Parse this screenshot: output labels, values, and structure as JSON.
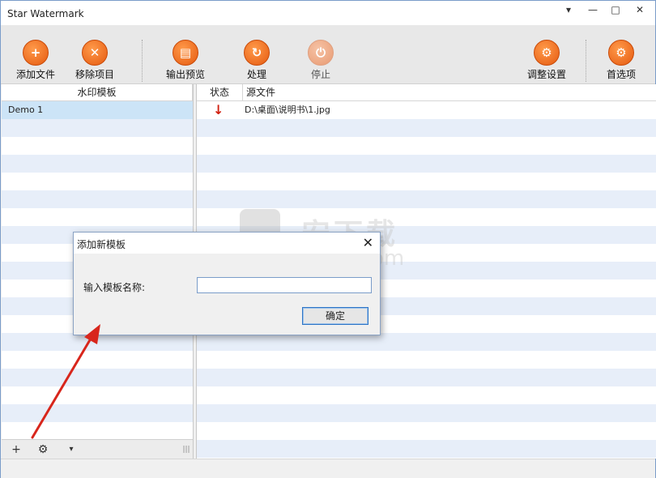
{
  "window": {
    "title": "Star Watermark"
  },
  "window_controls": {
    "menu": "▾",
    "minimize": "—",
    "maximize": "□",
    "close": "✕"
  },
  "toolbar": {
    "add_file": "添加文件",
    "remove_item": "移除项目",
    "output_preview": "输出预览",
    "process": "处理",
    "stop": "停止",
    "adjust_settings": "调整设置",
    "preferences": "首选项"
  },
  "left_panel": {
    "header": "水印模板",
    "templates": [
      "Demo 1"
    ]
  },
  "right_panel": {
    "columns": {
      "status": "状态",
      "source": "源文件"
    },
    "files": [
      {
        "status_icon": "down-arrow",
        "source": "D:\\桌面\\说明书\\1.jpg"
      }
    ]
  },
  "left_footer": {
    "add": "+",
    "settings": "⚙",
    "dropdown": "▾",
    "grip": "|||"
  },
  "dialog": {
    "title": "添加新模板",
    "label": "输入模板名称:",
    "input_value": "",
    "ok": "确定",
    "close": "✕"
  },
  "watermark": {
    "cn": "安下载",
    "en": "anxz.com"
  },
  "colors": {
    "accent": "#e55a10",
    "selection": "#cce4f7",
    "alt_row": "#e7eef9",
    "arrow": "#d02010"
  }
}
